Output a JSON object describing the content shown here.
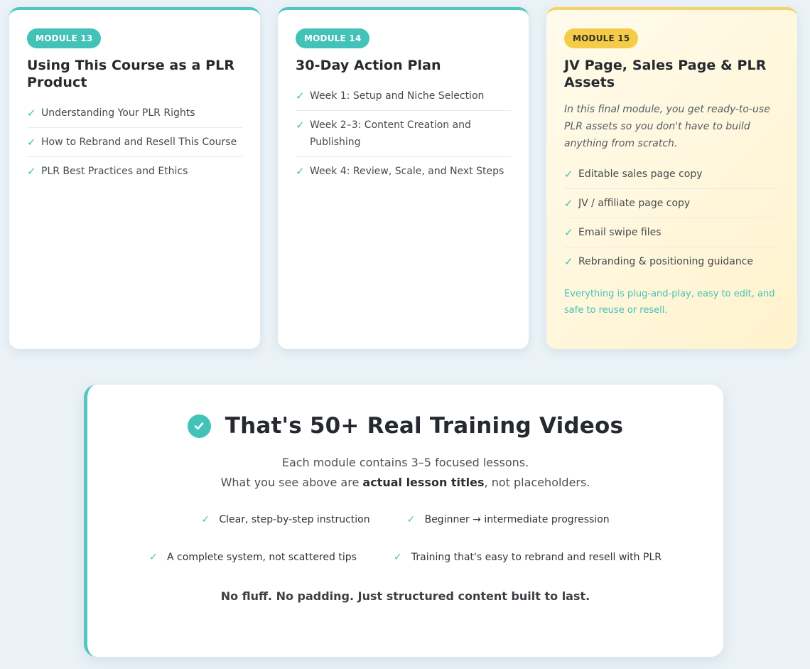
{
  "modules": [
    {
      "badge": "MODULE 13",
      "title": "Using This Course as a PLR Product",
      "lessons": [
        "Understanding Your PLR Rights",
        "How to Rebrand and Resell This Course",
        "PLR Best Practices and Ethics"
      ]
    },
    {
      "badge": "MODULE 14",
      "title": "30-Day Action Plan",
      "lessons": [
        "Week 1: Setup and Niche Selection",
        "Week 2–3: Content Creation and Publishing",
        "Week 4: Review, Scale, and Next Steps"
      ]
    },
    {
      "badge": "MODULE 15",
      "title": "JV Page, Sales Page & PLR Assets",
      "intro": "In this final module, you get ready-to-use PLR assets so you don't have to build anything from scratch.",
      "lessons": [
        "Editable sales page copy",
        "JV / affiliate page copy",
        "Email swipe files",
        "Rebranding & positioning guidance"
      ],
      "closing": "Everything is plug-and-play, easy to edit, and safe to reuse or resell."
    }
  ],
  "summary": {
    "title": "That's 50+ Real Training Videos",
    "line1": "Each module contains 3–5 focused lessons.",
    "line2_prefix": "What you see above are ",
    "line2_bold": "actual lesson titles",
    "line2_suffix": ", not placeholders.",
    "features": [
      "Clear, step-by-step instruction",
      "Beginner → intermediate progression",
      "A complete system, not scattered tips",
      "Training that's easy to rebrand and resell with PLR"
    ],
    "tagline": "No fluff. No padding. Just structured content built to last."
  },
  "icons": {
    "check": "check-icon",
    "check_circle": "check-circle-icon"
  },
  "colors": {
    "accent": "#43c2b8",
    "gold": "#f5cc4a",
    "background": "#eaf2f7"
  }
}
